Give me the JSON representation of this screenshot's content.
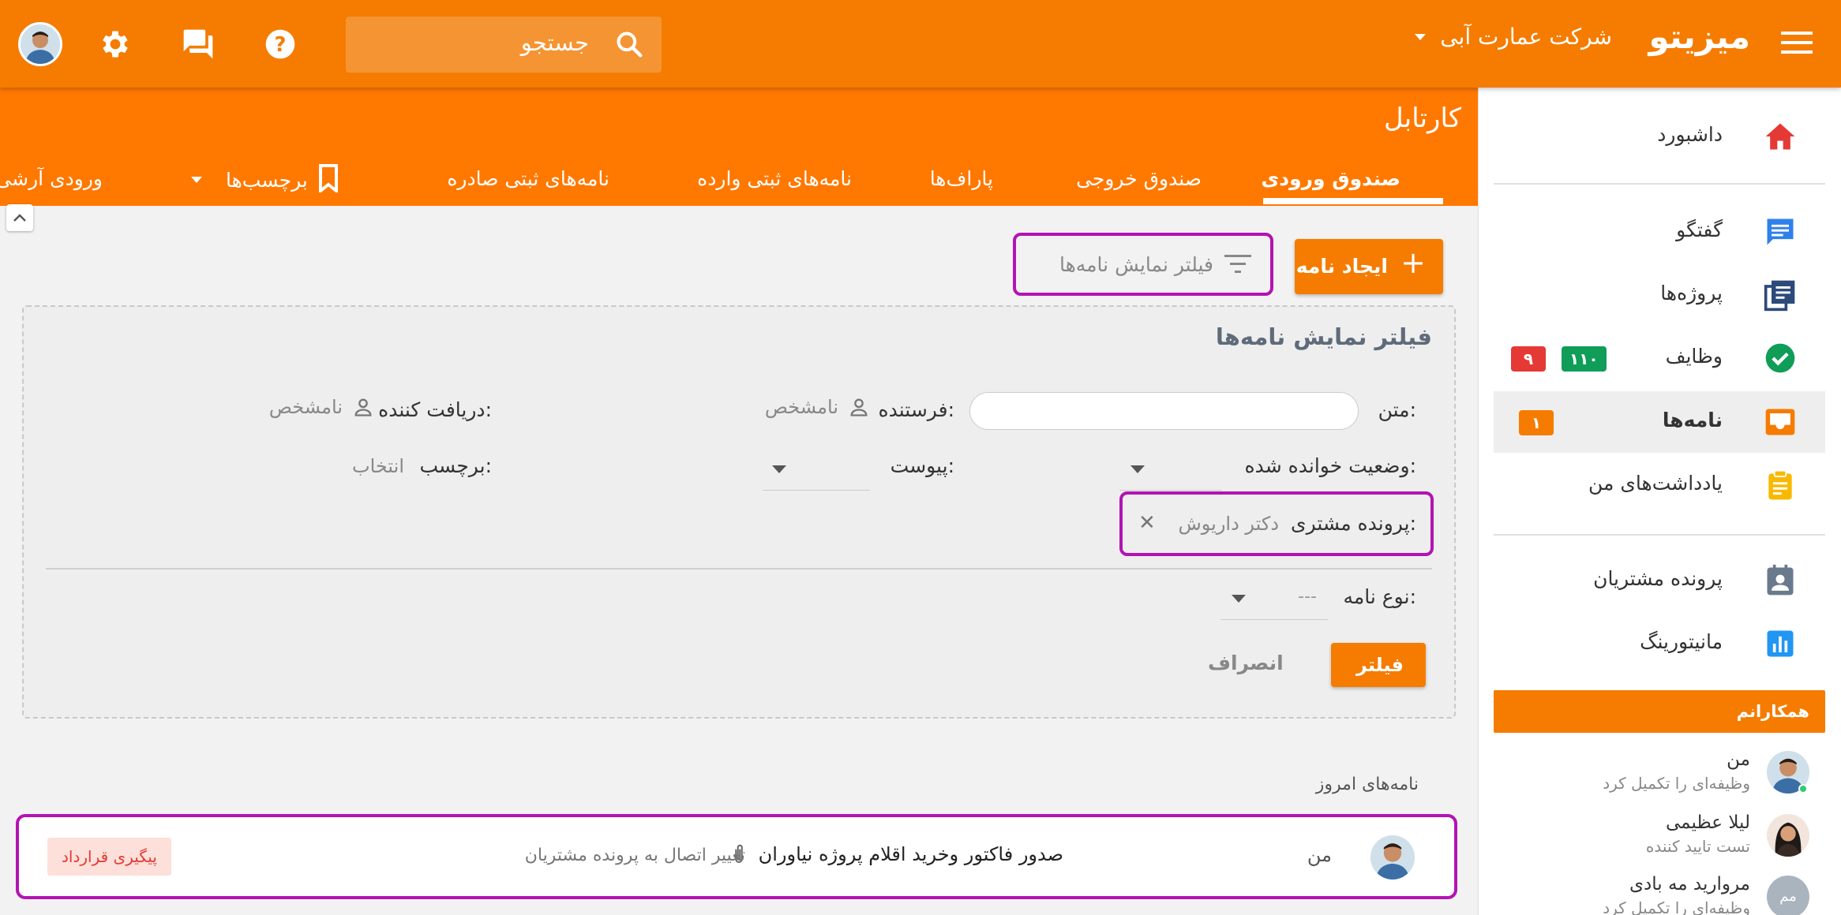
{
  "topbar": {
    "brand": "میزیتو",
    "company": "شرکت عمارت آبی",
    "search_placeholder": "جستجو"
  },
  "sidebar": {
    "items": [
      {
        "label": "داشبورد",
        "icon": "home-icon"
      },
      {
        "label": "گفتگو",
        "icon": "chat-icon"
      },
      {
        "label": "پروژه‌ها",
        "icon": "projects-icon"
      },
      {
        "label": "وظایف",
        "icon": "check-circle-icon",
        "badges": [
          "۱۱۰",
          "۹"
        ]
      },
      {
        "label": "نامه‌ها",
        "icon": "inbox-icon",
        "badges": [
          "۱"
        ]
      },
      {
        "label": "یادداشت‌های من",
        "icon": "clipboard-icon"
      },
      {
        "label": "پرونده مشتریان",
        "icon": "contact-card-icon"
      },
      {
        "label": "مانیتورینگ",
        "icon": "bar-chart-icon"
      }
    ],
    "colleagues_title": "همکارانم",
    "colleagues": [
      {
        "name": "من",
        "status": "وظیفه‌ای را تکمیل کرد"
      },
      {
        "name": "لیلا عظیمی",
        "status": "تست تایید کننده"
      },
      {
        "name": "مروارید مه بادی",
        "status": "وظیفه‌ای را تکمیل کرد",
        "initials": "مم"
      }
    ]
  },
  "main": {
    "title": "کارتابل",
    "tabs": [
      "صندوق ورودی",
      "صندوق خروجی",
      "پاراف‌ها",
      "نامه‌های ثبتی وارده",
      "نامه‌های ثبتی صادره",
      "برچسب‌ها",
      "ورودی آرشی"
    ],
    "create_button": "ایجاد نامه",
    "filter_button": "فیلتر نمایش نامه‌ها"
  },
  "filter": {
    "title": "فیلتر نمایش نامه‌ها",
    "text_label": "متن:",
    "sender_label": "فرستنده:",
    "sender_value": "نامشخص",
    "receiver_label": "دریافت کننده:",
    "receiver_value": "نامشخص",
    "read_status_label": "وضعیت خوانده شده:",
    "attachment_label": "پیوست:",
    "tag_label": "برچسب:",
    "tag_value": "انتخاب",
    "customer_file_label": "پرونده مشتری:",
    "customer_file_value": "دکتر داریوش",
    "letter_type_label": "نوع نامه:",
    "letter_type_value": "---",
    "apply_button": "فیلتر",
    "cancel_button": "انصراف"
  },
  "today": {
    "title": "نامه‌های امروز",
    "letters": [
      {
        "sender": "من",
        "subject": "صدور فاکتور وخرید اقلام پروژه نیاوران",
        "description": "تغییر اتصال به پرونده مشتریان",
        "tag": "پیگیری قرارداد"
      }
    ]
  },
  "colors": {
    "primary": "#f57c00",
    "header": "#ff7800",
    "highlight": "#b313b3"
  }
}
